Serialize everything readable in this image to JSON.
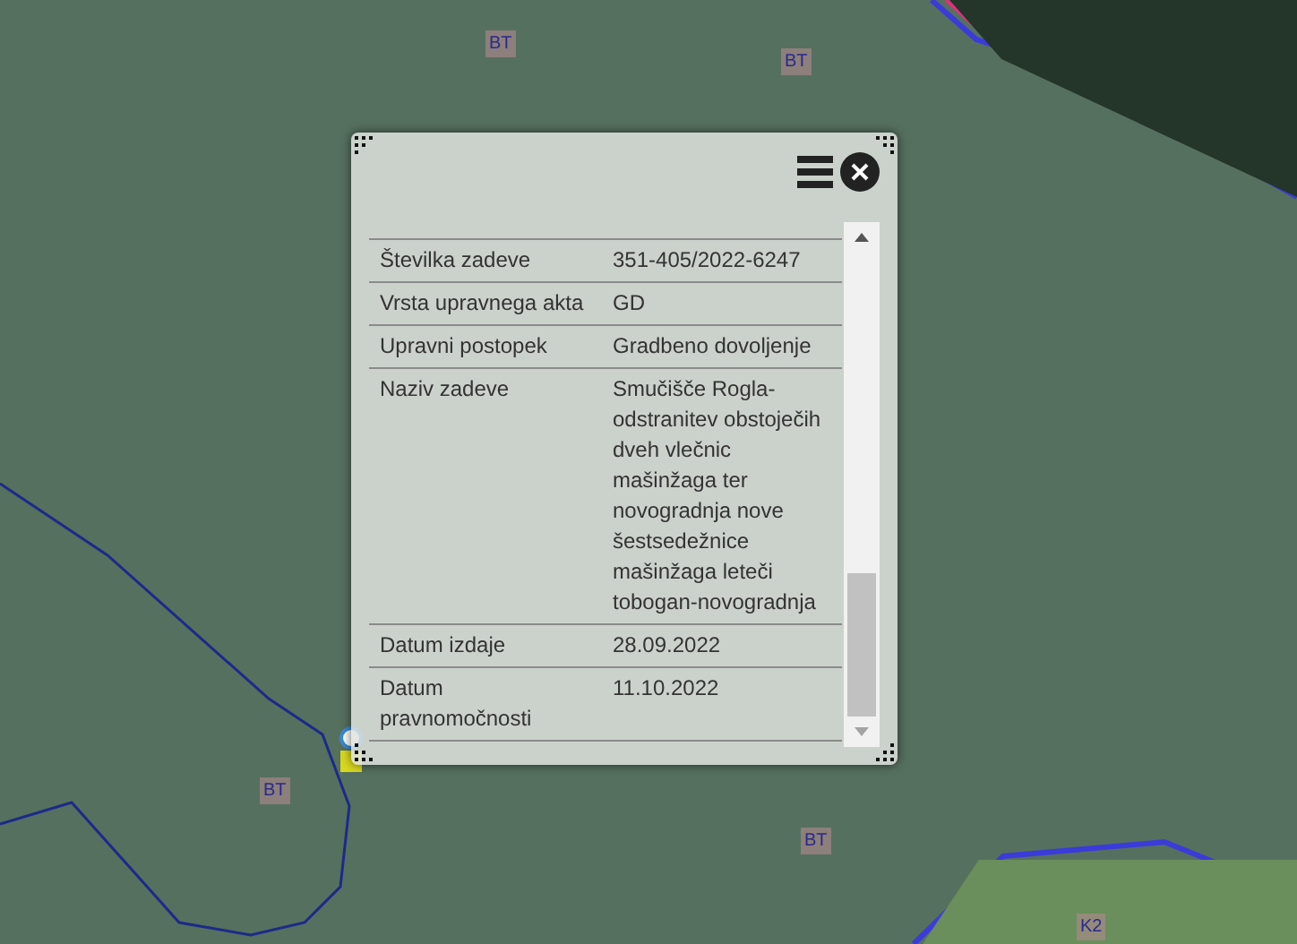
{
  "map": {
    "labels": [
      {
        "text": "BT"
      },
      {
        "text": "BT"
      },
      {
        "text": "BT"
      },
      {
        "text": "BT"
      },
      {
        "text": "K2"
      }
    ]
  },
  "popup": {
    "rows": [
      {
        "label": "Številka zadeve",
        "value": "351-405/2022-6247"
      },
      {
        "label": "Vrsta upravnega akta",
        "value": "GD"
      },
      {
        "label": "Upravni postopek",
        "value": "Gradbeno dovoljenje"
      },
      {
        "label": "Naziv zadeve",
        "value": "Smučišče Rogla-odstranitev obstoječih dveh vlečnic mašinžaga ter novogradnja nove šestsedežnice mašinžaga leteči tobogan-novogradnja"
      },
      {
        "label": "Datum izdaje",
        "value": "28.09.2022"
      },
      {
        "label": "Datum pravnomočnosti",
        "value": "11.10.2022"
      }
    ]
  }
}
